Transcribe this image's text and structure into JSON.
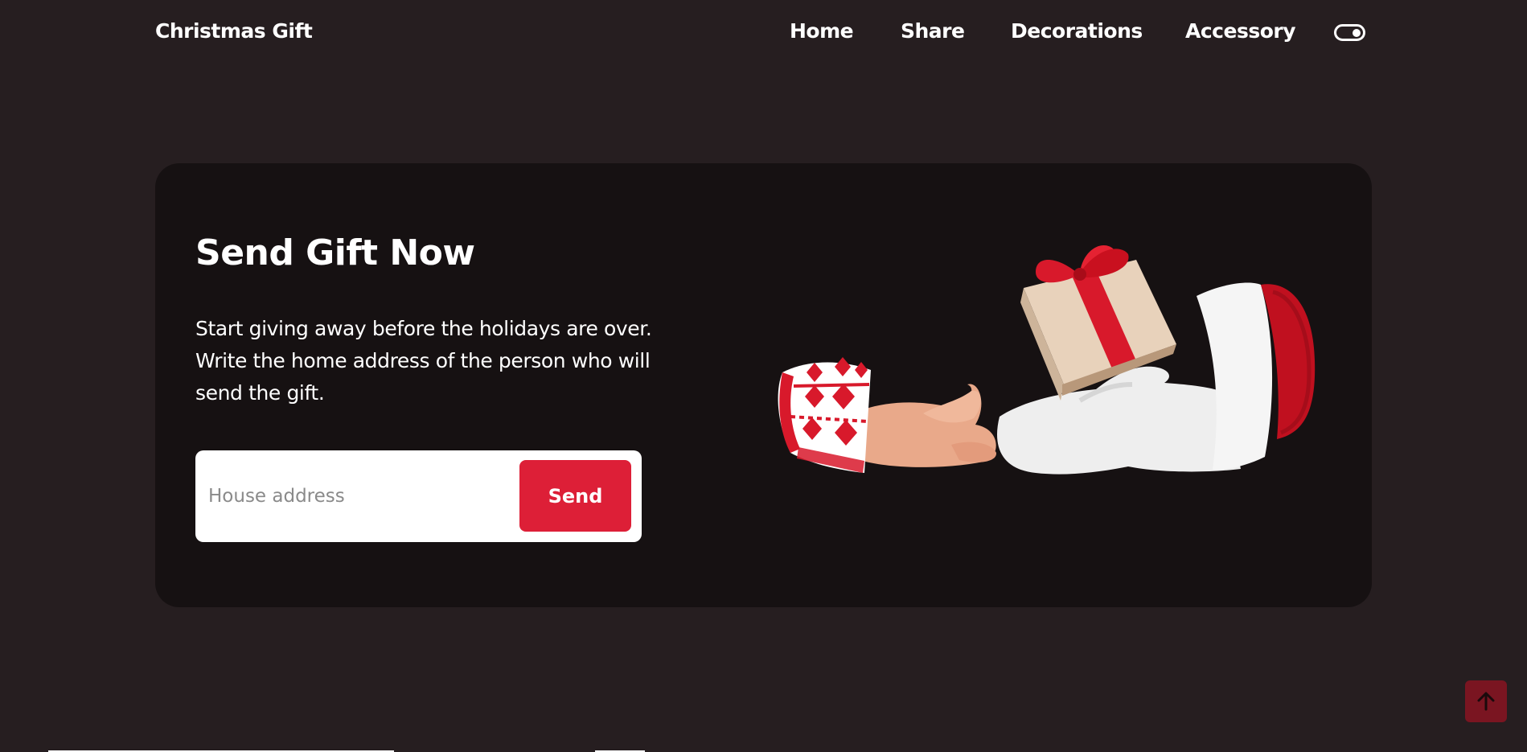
{
  "header": {
    "logo": "Christmas Gift",
    "nav": [
      "Home",
      "Share",
      "Decorations",
      "Accessory"
    ],
    "theme_toggle_icon": "toggle-switch-icon"
  },
  "hero": {
    "title": "Send Gift Now",
    "description": "Start giving away before the holidays are over. Write the home address of the person who will send the gift.",
    "input": {
      "placeholder": "House address",
      "value": ""
    },
    "send_label": "Send",
    "image": "santa-hands-giving-gift"
  },
  "scroll_top_icon": "arrow-up-icon",
  "colors": {
    "background": "#261e20",
    "card": "#161112",
    "accent": "#dd1f37",
    "scroll_button": "#7a1521"
  }
}
